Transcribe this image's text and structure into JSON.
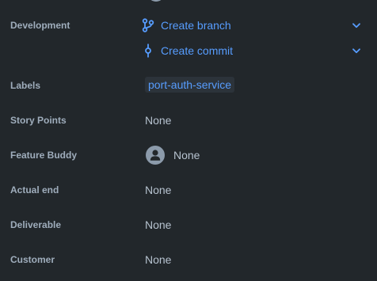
{
  "fields": {
    "development": {
      "label": "Development",
      "create_branch": "Create branch",
      "create_commit": "Create commit"
    },
    "labels": {
      "label": "Labels",
      "chip": "port-auth-service"
    },
    "story_points": {
      "label": "Story Points",
      "value": "None"
    },
    "feature_buddy": {
      "label": "Feature Buddy",
      "value": "None"
    },
    "actual_end": {
      "label": "Actual end",
      "value": "None"
    },
    "deliverable": {
      "label": "Deliverable",
      "value": "None"
    },
    "customer": {
      "label": "Customer",
      "value": "None"
    }
  },
  "icons": {
    "branch": "branch-icon",
    "commit": "commit-icon",
    "chevron": "chevron-down-icon",
    "avatar": "user-avatar-icon"
  },
  "colors": {
    "background": "#22272b",
    "label_text": "#9fadbc",
    "value_text": "#b6c2cf",
    "link_blue": "#579dff",
    "chip_background": "#2c333a"
  }
}
